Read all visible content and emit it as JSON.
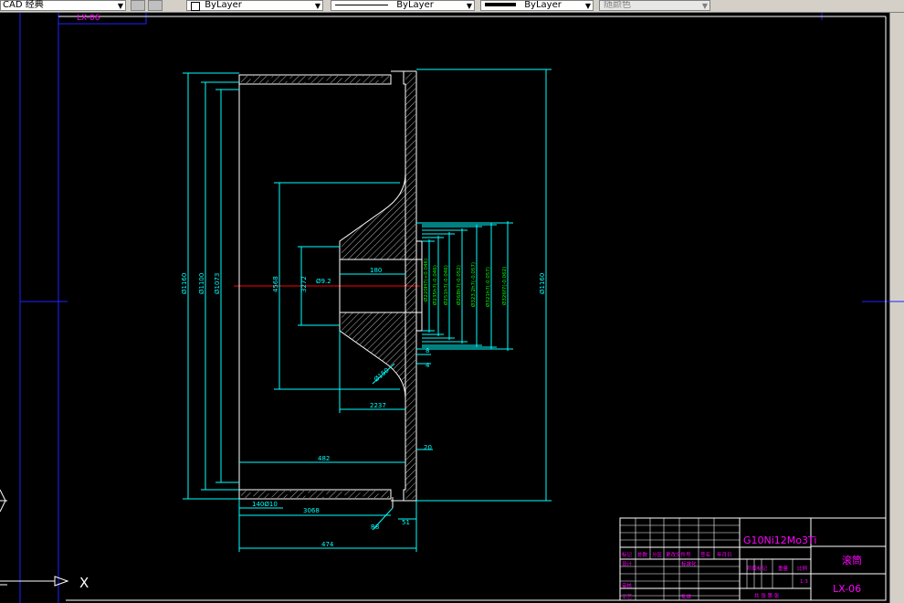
{
  "toolbar": {
    "workspace": "CAD 经典",
    "layer_control": "ByLayer",
    "linetype_control": "ByLayer",
    "lineweight_control": "ByLayer",
    "plotstyle_control": "随颜色"
  },
  "drawing": {
    "frame_tab_text": "LX-06",
    "ucs_label_x": "X",
    "dimensions": {
      "phi1160_left": "Ø1160",
      "phi1100": "Ø1100",
      "phi1073": "Ø1073",
      "d4568": "4568",
      "d3272": "3272",
      "phi9_2": "Ø9.2",
      "d180": "180",
      "d2237": "2237",
      "phi150": "Ø150",
      "phi1160_right": "Ø1160",
      "d482": "482",
      "d20": "20",
      "d140": "140Ø10",
      "d3068": "3068",
      "r8": "R8",
      "d51": "51",
      "d474": "474",
      "d8": "8",
      "d4": "4"
    },
    "green_dims": [
      "Ø220H7(+0.046)",
      "Ø235h7(-0.046)",
      "Ø251h7(-0.046)",
      "Ø268h7(-0.052)",
      "Ø323.2h7(-0.057)",
      "Ø321h7(-0.057)",
      "Ø326f7(-0.062)"
    ]
  },
  "title_block": {
    "material": "G10Ni12Mo3Ti",
    "part_name": "滚筒",
    "drawing_no": "LX-06",
    "revision_labels": [
      "标记",
      "处数",
      "分区",
      "更改文件号",
      "签名",
      "年月日"
    ],
    "design_label": "设计",
    "standard_label": "标准化",
    "review_label": "审核",
    "process_label": "工艺",
    "approve_label": "批准",
    "stage_label": "阶段标记",
    "weight_label": "重量",
    "scale_label": "比例",
    "scale_value": "1:3",
    "sheets_label": "共  张  第  张"
  },
  "colors": {
    "cyan": "#00ffff",
    "white": "#ffffff",
    "blue": "#2222ff",
    "green": "#00ff00",
    "magenta": "#ff00ff",
    "red": "#ff0000"
  }
}
